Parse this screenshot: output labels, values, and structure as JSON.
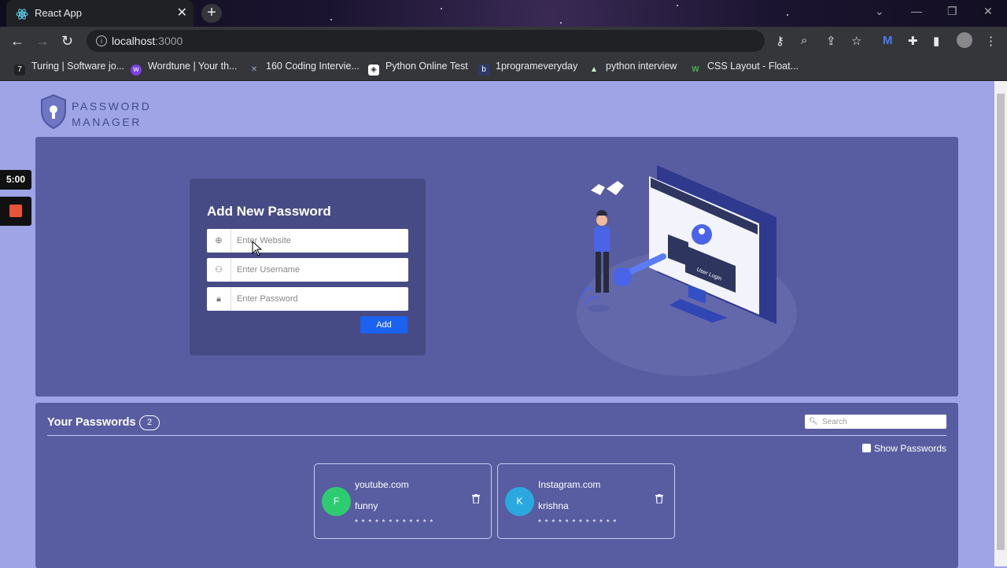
{
  "browser": {
    "tab_title": "React App",
    "url_host": "localhost",
    "url_port": ":3000",
    "bookmarks": [
      {
        "label": "Turing | Software jo...",
        "icon": "turing-icon"
      },
      {
        "label": "Wordtune | Your th...",
        "icon": "wordtune-icon"
      },
      {
        "label": "160 Coding Intervie...",
        "icon": "coding-icon"
      },
      {
        "label": "Python Online Test",
        "icon": "python-test-icon"
      },
      {
        "label": "1programeveryday",
        "icon": "blog-icon"
      },
      {
        "label": "python interview",
        "icon": "python-interview-icon"
      },
      {
        "label": "CSS Layout - Float...",
        "icon": "w3schools-icon"
      }
    ]
  },
  "overlay": {
    "timer": "5:00"
  },
  "app": {
    "logo_line1": "PASSWORD",
    "logo_line2": "MANAGER",
    "form": {
      "title": "Add New Password",
      "website_placeholder": "Enter Website",
      "username_placeholder": "Enter Username",
      "password_placeholder": "Enter Password",
      "add_label": "Add"
    },
    "illustration_caption": "User Login",
    "passwords": {
      "title": "Your Passwords",
      "count": "2",
      "search_placeholder": "Search",
      "show_label": "Show Passwords",
      "items": [
        {
          "initial": "F",
          "website": "youtube.com",
          "username": "funny",
          "masked": "* * * * * * * * * * * *",
          "color": "#2ecc71"
        },
        {
          "initial": "K",
          "website": "Instagram.com",
          "username": "krishna",
          "masked": "* * * * * * * * * * * *",
          "color": "#2aa8e0"
        }
      ]
    }
  }
}
